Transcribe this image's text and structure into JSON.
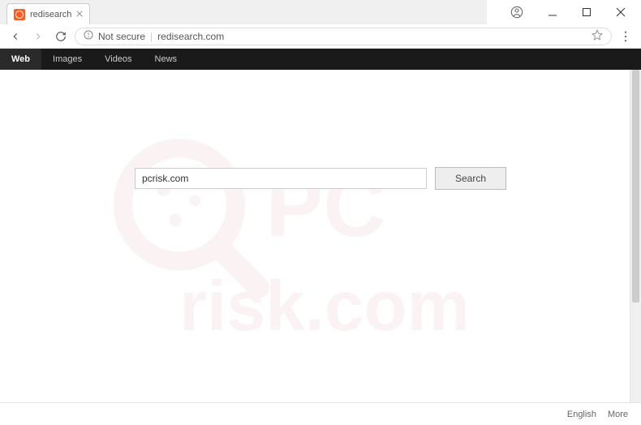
{
  "browser": {
    "tab_title": "redisearch",
    "url": "redisearch.com",
    "security_label": "Not secure"
  },
  "nav": {
    "items": [
      {
        "label": "Web",
        "active": true
      },
      {
        "label": "Images",
        "active": false
      },
      {
        "label": "Videos",
        "active": false
      },
      {
        "label": "News",
        "active": false
      }
    ]
  },
  "search": {
    "value": "pcrisk.com",
    "button_label": "Search"
  },
  "footer": {
    "language": "English",
    "more": "More"
  },
  "watermark": {
    "text": "PC risk.com"
  }
}
